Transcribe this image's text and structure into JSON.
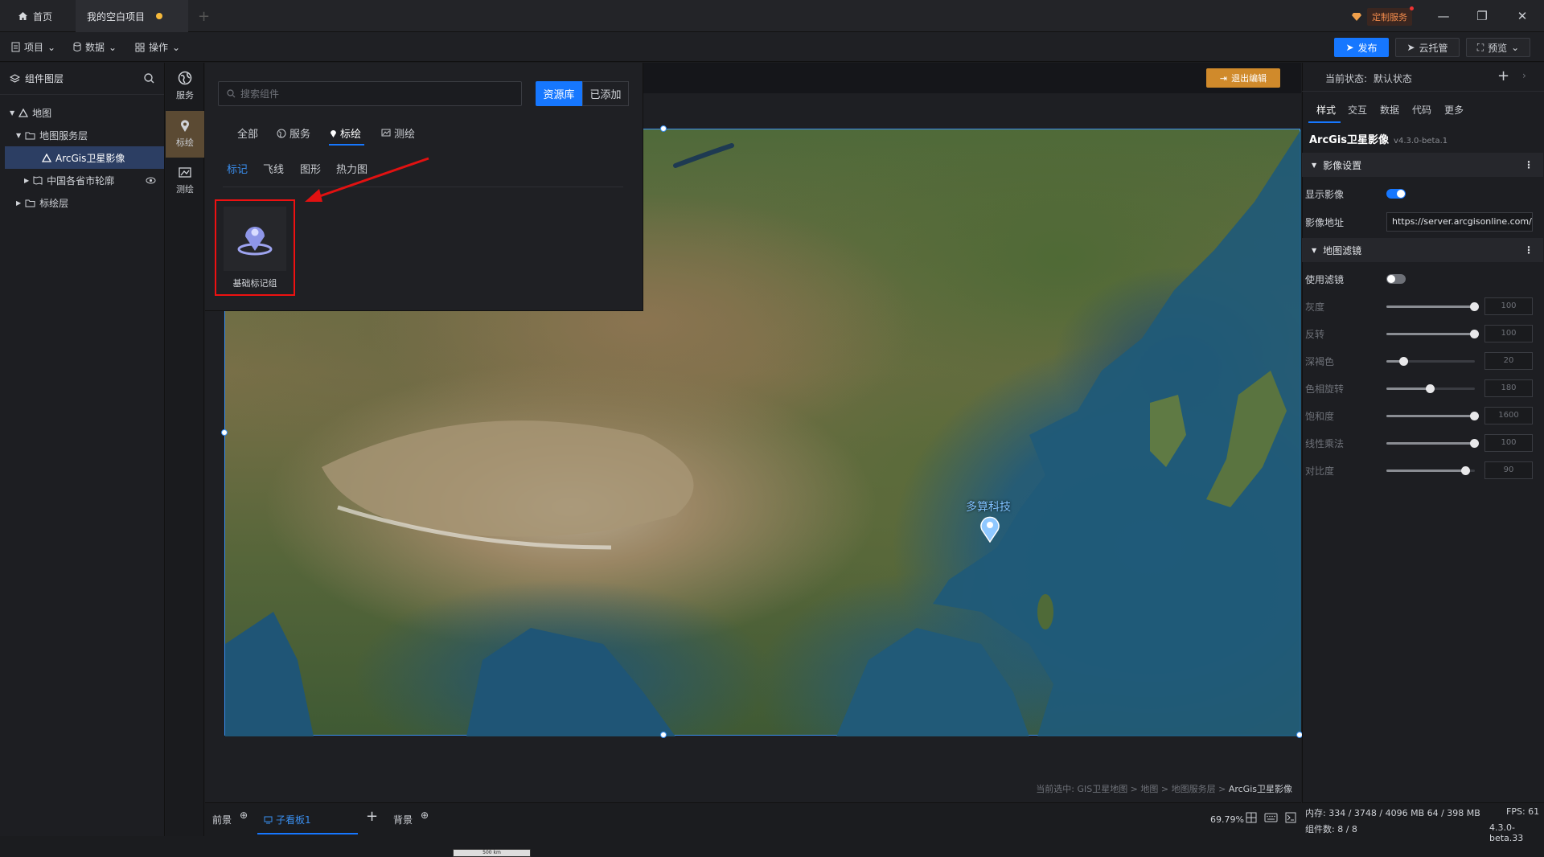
{
  "titlebar": {
    "home_tab": "首页",
    "project_tab": "我的空白项目",
    "custom_service": "定制服务"
  },
  "menubar": {
    "project": "项目",
    "data": "数据",
    "operate": "操作",
    "publish": "发布",
    "cloud_host": "云托管",
    "preview": "预览"
  },
  "layers": {
    "title": "组件图层",
    "items": [
      {
        "label": "地图"
      },
      {
        "label": "地图服务层"
      },
      {
        "label": "ArcGis卫星影像"
      },
      {
        "label": "中国各省市轮廓"
      },
      {
        "label": "标绘层"
      }
    ]
  },
  "rail": {
    "service": "服务",
    "plot": "标绘",
    "measure": "测绘"
  },
  "library": {
    "search_placeholder": "搜索组件",
    "tab_library": "资源库",
    "tab_added": "已添加",
    "categories": [
      "全部",
      "服务",
      "标绘",
      "测绘"
    ],
    "subcategories": [
      "标记",
      "飞线",
      "图形",
      "热力图"
    ],
    "card_label": "基础标记组"
  },
  "canvas": {
    "exit_edit": "退出编辑",
    "marker_label": "多算科技",
    "scale_text": "500 km",
    "breadcrumb_prefix": "当前选中: ",
    "breadcrumb_path": "GIS卫星地图 > 地图 > 地图服务层 > ",
    "breadcrumb_last": "ArcGis卫星影像"
  },
  "inspector": {
    "state_label": "当前状态:",
    "state_value": "默认状态",
    "tabs": [
      "样式",
      "交互",
      "数据",
      "代码",
      "更多"
    ],
    "component_title": "ArcGis卫星影像",
    "component_version": "v4.3.0-beta.1",
    "section_imagery": "影像设置",
    "show_imagery": "显示影像",
    "imagery_url_label": "影像地址",
    "imagery_url": "https://server.arcgisonline.com/arcgis",
    "show_imagery_on": true,
    "section_filter": "地图滤镜",
    "use_filter": "使用滤镜",
    "use_filter_on": false,
    "filters": [
      {
        "label": "灰度",
        "value": "100",
        "level": 1.0
      },
      {
        "label": "反转",
        "value": "100",
        "level": 1.0
      },
      {
        "label": "深褐色",
        "value": "20",
        "level": 0.2
      },
      {
        "label": "色相旋转",
        "value": "180",
        "level": 0.5
      },
      {
        "label": "饱和度",
        "value": "1600",
        "level": 1.0
      },
      {
        "label": "线性乘法",
        "value": "100",
        "level": 1.0
      },
      {
        "label": "对比度",
        "value": "90",
        "level": 0.9
      }
    ]
  },
  "bottom": {
    "foreground": "前景",
    "child_panel": "子看板1",
    "background": "背景",
    "zoom": "69.79%",
    "memory": "内存: 334 / 3748 / 4096 MB  64 / 398 MB",
    "component_count": "组件数: 8 / 8",
    "fps": "FPS: 61",
    "version": "4.3.0-beta.33"
  },
  "colors": {
    "accent": "#1677ff",
    "highlight_box": "#e11111",
    "arrow": "#e11111",
    "plot_active": "#5b4a33"
  }
}
